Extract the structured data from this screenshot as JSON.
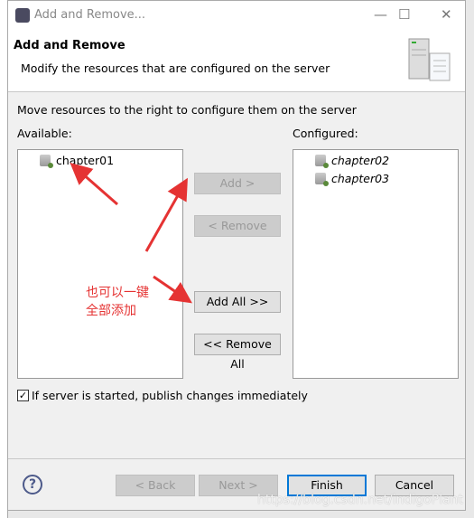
{
  "window": {
    "title": "Add and Remove...",
    "minimize": "—",
    "maximize": "☐",
    "close": "✕"
  },
  "header": {
    "title": "Add and Remove",
    "description": "Modify the resources that are configured on the server",
    "icon": "server-icon"
  },
  "instruction": "Move resources to the right to configure them on the server",
  "available": {
    "label": "Available:",
    "items": [
      "chapter01"
    ]
  },
  "configured": {
    "label": "Configured:",
    "items": [
      "chapter02",
      "chapter03"
    ]
  },
  "buttons": {
    "add": "Add >",
    "remove": "< Remove",
    "add_all": "Add All >>",
    "remove_all": "<< Remove All"
  },
  "publish": {
    "checked": true,
    "label": "If server is started, publish changes immediately",
    "mark": "✓"
  },
  "footer": {
    "help": "?",
    "back": "< Back",
    "next": "Next >",
    "finish": "Finish",
    "cancel": "Cancel"
  },
  "annotation": {
    "text": "也可以一键\n全部添加",
    "color": "#e53333"
  },
  "watermark": "https://blog.csdn.net/indigoPlant"
}
